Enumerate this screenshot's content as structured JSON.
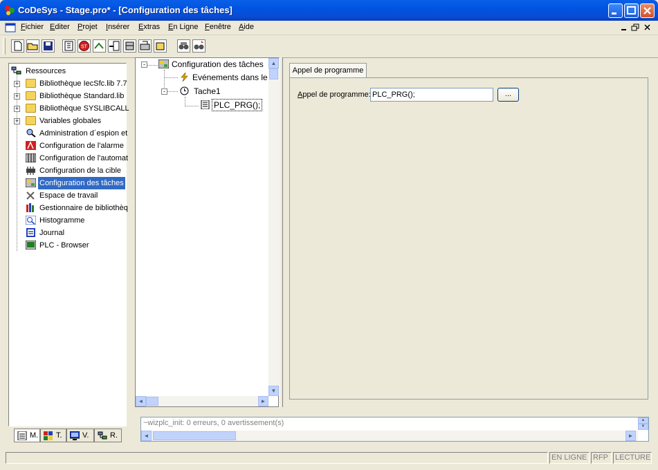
{
  "window": {
    "title": "CoDeSys - Stage.pro* - [Configuration des tâches]",
    "accent": "#0054e3"
  },
  "menu": [
    {
      "label": "Fichier",
      "u": "F",
      "rest": "ichier"
    },
    {
      "label": "Editer",
      "u": "E",
      "rest": "diter"
    },
    {
      "label": "Projet",
      "u": "P",
      "rest": "rojet"
    },
    {
      "label": "Insérer",
      "u": "I",
      "rest": "nsérer"
    },
    {
      "label": "Extras",
      "u": "E",
      "rest": "xtras"
    },
    {
      "label": "En Ligne",
      "u": "E",
      "rest": "n Ligne"
    },
    {
      "label": "Fenêtre",
      "u": "F",
      "rest": "enêtre"
    },
    {
      "label": "Aide",
      "u": "A",
      "rest": "ide"
    }
  ],
  "resources_tree": [
    {
      "label": "Ressources",
      "icon": "resources-icon",
      "level": 0,
      "expander": ""
    },
    {
      "label": "Bibliothèque IecSfc.lib 7.7",
      "icon": "folder-icon",
      "level": 1,
      "expander": "+"
    },
    {
      "label": "Bibliothèque Standard.lib",
      "icon": "folder-icon",
      "level": 1,
      "expander": "+"
    },
    {
      "label": "Bibliothèque SYSLIBCALL",
      "icon": "folder-icon",
      "level": 1,
      "expander": "+"
    },
    {
      "label": "Variables globales",
      "icon": "folder-icon",
      "level": 1,
      "expander": "+"
    },
    {
      "label": "Administration d´espion et",
      "icon": "watch-icon",
      "level": 1,
      "expander": ""
    },
    {
      "label": "Configuration de l'alarme",
      "icon": "alarm-icon",
      "level": 1,
      "expander": ""
    },
    {
      "label": "Configuration de l'automat",
      "icon": "plc-config-icon",
      "level": 1,
      "expander": ""
    },
    {
      "label": "Configuration de la cible",
      "icon": "target-icon",
      "level": 1,
      "expander": ""
    },
    {
      "label": "Configuration des tâches",
      "icon": "task-config-icon",
      "level": 1,
      "expander": "",
      "selected": true
    },
    {
      "label": "Espace de travail",
      "icon": "tools-icon",
      "level": 1,
      "expander": ""
    },
    {
      "label": "Gestionnaire de bibliothèq",
      "icon": "library-icon",
      "level": 1,
      "expander": ""
    },
    {
      "label": "Histogramme",
      "icon": "histogram-icon",
      "level": 1,
      "expander": ""
    },
    {
      "label": "Journal",
      "icon": "journal-icon",
      "level": 1,
      "expander": ""
    },
    {
      "label": "PLC - Browser",
      "icon": "browser-icon",
      "level": 1,
      "expander": ""
    }
  ],
  "bottom_tabs": [
    {
      "label": "M.",
      "icon": "pou-icon"
    },
    {
      "label": "T.",
      "icon": "types-icon"
    },
    {
      "label": "V.",
      "icon": "visu-icon"
    },
    {
      "label": "R.",
      "icon": "resources-tab-icon"
    }
  ],
  "task_tree": [
    {
      "label": "Configuration des tâches",
      "icon": "task-config-icon",
      "expander": "-"
    },
    {
      "label": "Evénements dans le",
      "icon": "event-icon",
      "expander": ""
    },
    {
      "label": "Tache1",
      "icon": "clock-icon",
      "expander": "-"
    },
    {
      "label": "PLC_PRG();",
      "icon": "program-icon",
      "expander": ""
    }
  ],
  "detail": {
    "tab_label": "Appel de programme",
    "field_label_u": "A",
    "field_label_rest": "ppel de programme:",
    "field_value": "PLC_PRG();",
    "browse_label": "..."
  },
  "messages": {
    "text": "~wizplc_init: 0 erreurs, 0 avertissement(s)"
  },
  "status": {
    "online": "EN LIGNE",
    "rfp": "RFP",
    "read": "LECTURE"
  }
}
